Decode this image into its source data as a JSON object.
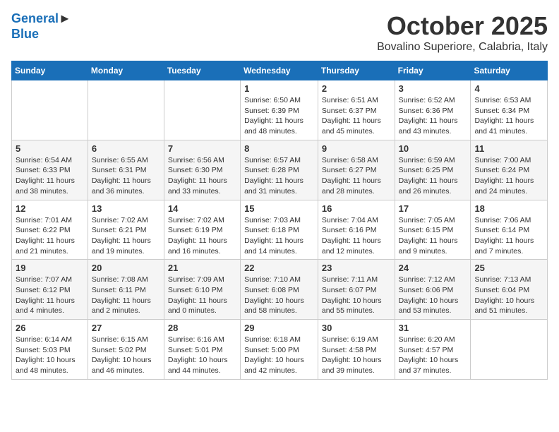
{
  "header": {
    "logo_line1": "General",
    "logo_line2": "Blue",
    "month": "October 2025",
    "location": "Bovalino Superiore, Calabria, Italy"
  },
  "days_of_week": [
    "Sunday",
    "Monday",
    "Tuesday",
    "Wednesday",
    "Thursday",
    "Friday",
    "Saturday"
  ],
  "weeks": [
    [
      {
        "day": "",
        "text": ""
      },
      {
        "day": "",
        "text": ""
      },
      {
        "day": "",
        "text": ""
      },
      {
        "day": "1",
        "text": "Sunrise: 6:50 AM\nSunset: 6:39 PM\nDaylight: 11 hours and 48 minutes."
      },
      {
        "day": "2",
        "text": "Sunrise: 6:51 AM\nSunset: 6:37 PM\nDaylight: 11 hours and 45 minutes."
      },
      {
        "day": "3",
        "text": "Sunrise: 6:52 AM\nSunset: 6:36 PM\nDaylight: 11 hours and 43 minutes."
      },
      {
        "day": "4",
        "text": "Sunrise: 6:53 AM\nSunset: 6:34 PM\nDaylight: 11 hours and 41 minutes."
      }
    ],
    [
      {
        "day": "5",
        "text": "Sunrise: 6:54 AM\nSunset: 6:33 PM\nDaylight: 11 hours and 38 minutes."
      },
      {
        "day": "6",
        "text": "Sunrise: 6:55 AM\nSunset: 6:31 PM\nDaylight: 11 hours and 36 minutes."
      },
      {
        "day": "7",
        "text": "Sunrise: 6:56 AM\nSunset: 6:30 PM\nDaylight: 11 hours and 33 minutes."
      },
      {
        "day": "8",
        "text": "Sunrise: 6:57 AM\nSunset: 6:28 PM\nDaylight: 11 hours and 31 minutes."
      },
      {
        "day": "9",
        "text": "Sunrise: 6:58 AM\nSunset: 6:27 PM\nDaylight: 11 hours and 28 minutes."
      },
      {
        "day": "10",
        "text": "Sunrise: 6:59 AM\nSunset: 6:25 PM\nDaylight: 11 hours and 26 minutes."
      },
      {
        "day": "11",
        "text": "Sunrise: 7:00 AM\nSunset: 6:24 PM\nDaylight: 11 hours and 24 minutes."
      }
    ],
    [
      {
        "day": "12",
        "text": "Sunrise: 7:01 AM\nSunset: 6:22 PM\nDaylight: 11 hours and 21 minutes."
      },
      {
        "day": "13",
        "text": "Sunrise: 7:02 AM\nSunset: 6:21 PM\nDaylight: 11 hours and 19 minutes."
      },
      {
        "day": "14",
        "text": "Sunrise: 7:02 AM\nSunset: 6:19 PM\nDaylight: 11 hours and 16 minutes."
      },
      {
        "day": "15",
        "text": "Sunrise: 7:03 AM\nSunset: 6:18 PM\nDaylight: 11 hours and 14 minutes."
      },
      {
        "day": "16",
        "text": "Sunrise: 7:04 AM\nSunset: 6:16 PM\nDaylight: 11 hours and 12 minutes."
      },
      {
        "day": "17",
        "text": "Sunrise: 7:05 AM\nSunset: 6:15 PM\nDaylight: 11 hours and 9 minutes."
      },
      {
        "day": "18",
        "text": "Sunrise: 7:06 AM\nSunset: 6:14 PM\nDaylight: 11 hours and 7 minutes."
      }
    ],
    [
      {
        "day": "19",
        "text": "Sunrise: 7:07 AM\nSunset: 6:12 PM\nDaylight: 11 hours and 4 minutes."
      },
      {
        "day": "20",
        "text": "Sunrise: 7:08 AM\nSunset: 6:11 PM\nDaylight: 11 hours and 2 minutes."
      },
      {
        "day": "21",
        "text": "Sunrise: 7:09 AM\nSunset: 6:10 PM\nDaylight: 11 hours and 0 minutes."
      },
      {
        "day": "22",
        "text": "Sunrise: 7:10 AM\nSunset: 6:08 PM\nDaylight: 10 hours and 58 minutes."
      },
      {
        "day": "23",
        "text": "Sunrise: 7:11 AM\nSunset: 6:07 PM\nDaylight: 10 hours and 55 minutes."
      },
      {
        "day": "24",
        "text": "Sunrise: 7:12 AM\nSunset: 6:06 PM\nDaylight: 10 hours and 53 minutes."
      },
      {
        "day": "25",
        "text": "Sunrise: 7:13 AM\nSunset: 6:04 PM\nDaylight: 10 hours and 51 minutes."
      }
    ],
    [
      {
        "day": "26",
        "text": "Sunrise: 6:14 AM\nSunset: 5:03 PM\nDaylight: 10 hours and 48 minutes."
      },
      {
        "day": "27",
        "text": "Sunrise: 6:15 AM\nSunset: 5:02 PM\nDaylight: 10 hours and 46 minutes."
      },
      {
        "day": "28",
        "text": "Sunrise: 6:16 AM\nSunset: 5:01 PM\nDaylight: 10 hours and 44 minutes."
      },
      {
        "day": "29",
        "text": "Sunrise: 6:18 AM\nSunset: 5:00 PM\nDaylight: 10 hours and 42 minutes."
      },
      {
        "day": "30",
        "text": "Sunrise: 6:19 AM\nSunset: 4:58 PM\nDaylight: 10 hours and 39 minutes."
      },
      {
        "day": "31",
        "text": "Sunrise: 6:20 AM\nSunset: 4:57 PM\nDaylight: 10 hours and 37 minutes."
      },
      {
        "day": "",
        "text": ""
      }
    ]
  ]
}
